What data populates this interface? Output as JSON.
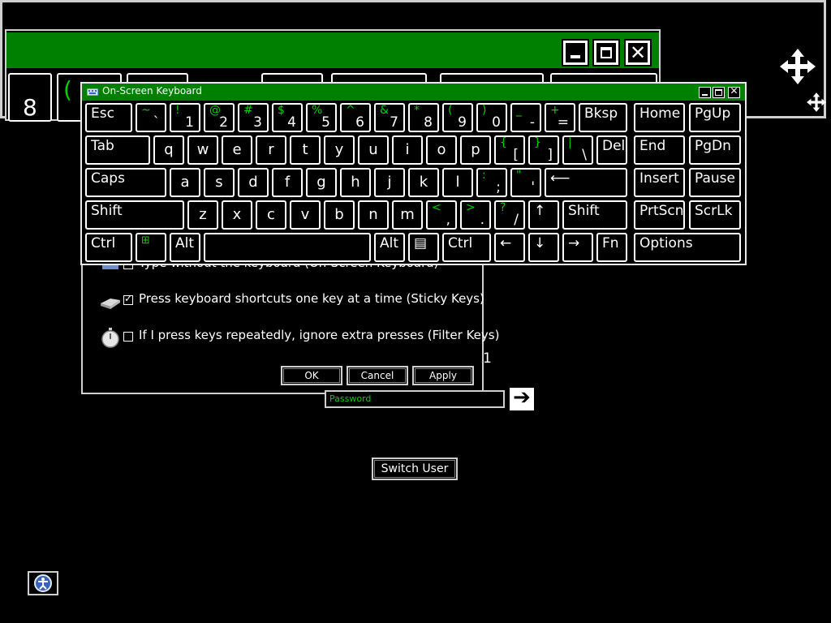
{
  "bg_keyboard": {
    "visible_keys": [
      "8",
      "("
    ],
    "move_icon": "move-arrows-icon"
  },
  "osk": {
    "title": "On-Screen Keyboard",
    "rows": [
      [
        {
          "label": "Esc"
        },
        {
          "shift": "~",
          "base": "`"
        },
        {
          "shift": "!",
          "base": "1"
        },
        {
          "shift": "@",
          "base": "2"
        },
        {
          "shift": "#",
          "base": "3"
        },
        {
          "shift": "$",
          "base": "4"
        },
        {
          "shift": "%",
          "base": "5"
        },
        {
          "shift": "^",
          "base": "6"
        },
        {
          "shift": "&",
          "base": "7"
        },
        {
          "shift": "*",
          "base": "8"
        },
        {
          "shift": "(",
          "base": "9"
        },
        {
          "shift": ")",
          "base": "0"
        },
        {
          "shift": "_",
          "base": "-"
        },
        {
          "shift": "+",
          "base": "="
        },
        {
          "label": "Bksp"
        },
        {
          "label": "Home"
        },
        {
          "label": "PgUp"
        }
      ],
      [
        {
          "label": "Tab"
        },
        {
          "center": "q"
        },
        {
          "center": "w"
        },
        {
          "center": "e"
        },
        {
          "center": "r"
        },
        {
          "center": "t"
        },
        {
          "center": "y"
        },
        {
          "center": "u"
        },
        {
          "center": "i"
        },
        {
          "center": "o"
        },
        {
          "center": "p"
        },
        {
          "shift": "{",
          "base": "["
        },
        {
          "shift": "}",
          "base": "]"
        },
        {
          "shift": "|",
          "base": "\\"
        },
        {
          "label": "Del"
        },
        {
          "label": "End"
        },
        {
          "label": "PgDn"
        }
      ],
      [
        {
          "label": "Caps"
        },
        {
          "center": "a"
        },
        {
          "center": "s"
        },
        {
          "center": "d"
        },
        {
          "center": "f"
        },
        {
          "center": "g"
        },
        {
          "center": "h"
        },
        {
          "center": "j"
        },
        {
          "center": "k"
        },
        {
          "center": "l"
        },
        {
          "shift": ":",
          "base": ";"
        },
        {
          "shift": "\"",
          "base": "'"
        },
        {
          "label": "⟵"
        },
        {
          "label": "Insert"
        },
        {
          "label": "Pause"
        }
      ],
      [
        {
          "label": "Shift"
        },
        {
          "center": "z"
        },
        {
          "center": "x"
        },
        {
          "center": "c"
        },
        {
          "center": "v"
        },
        {
          "center": "b"
        },
        {
          "center": "n"
        },
        {
          "center": "m"
        },
        {
          "shift": "<",
          "base": ","
        },
        {
          "shift": ">",
          "base": "."
        },
        {
          "shift": "?",
          "base": "/"
        },
        {
          "label": "↑"
        },
        {
          "label": "Shift"
        },
        {
          "label": "PrtScn"
        },
        {
          "label": "ScrLk"
        }
      ],
      [
        {
          "label": "Ctrl"
        },
        {
          "label": "⊞"
        },
        {
          "label": "Alt"
        },
        {
          "label": ""
        },
        {
          "label": "Alt"
        },
        {
          "label": "▤"
        },
        {
          "label": "Ctrl"
        },
        {
          "label": "←"
        },
        {
          "label": "↓"
        },
        {
          "label": "→"
        },
        {
          "label": "Fn"
        },
        {
          "label": "Options"
        }
      ]
    ]
  },
  "dialog": {
    "options": [
      {
        "label": "Type without the keyboard (On-Screen Keyboard)",
        "checked": false,
        "icon": "keyboard-icon"
      },
      {
        "label": "Press keyboard shortcuts one key at a time (Sticky Keys)",
        "checked": true,
        "icon": "sticky-keys-icon"
      },
      {
        "label": "If I press keys repeatedly, ignore extra presses (Filter Keys)",
        "checked": false,
        "icon": "stopwatch-icon"
      }
    ],
    "buttons": {
      "ok": "OK",
      "cancel": "Cancel",
      "apply": "Apply"
    }
  },
  "login": {
    "password_placeholder": "Password",
    "go_arrow": "➔",
    "stray": "1",
    "switch_user": "Switch User"
  },
  "colors": {
    "accent": "#008000",
    "key_text_alt": "#00d000",
    "border": "#cfcfcf"
  }
}
